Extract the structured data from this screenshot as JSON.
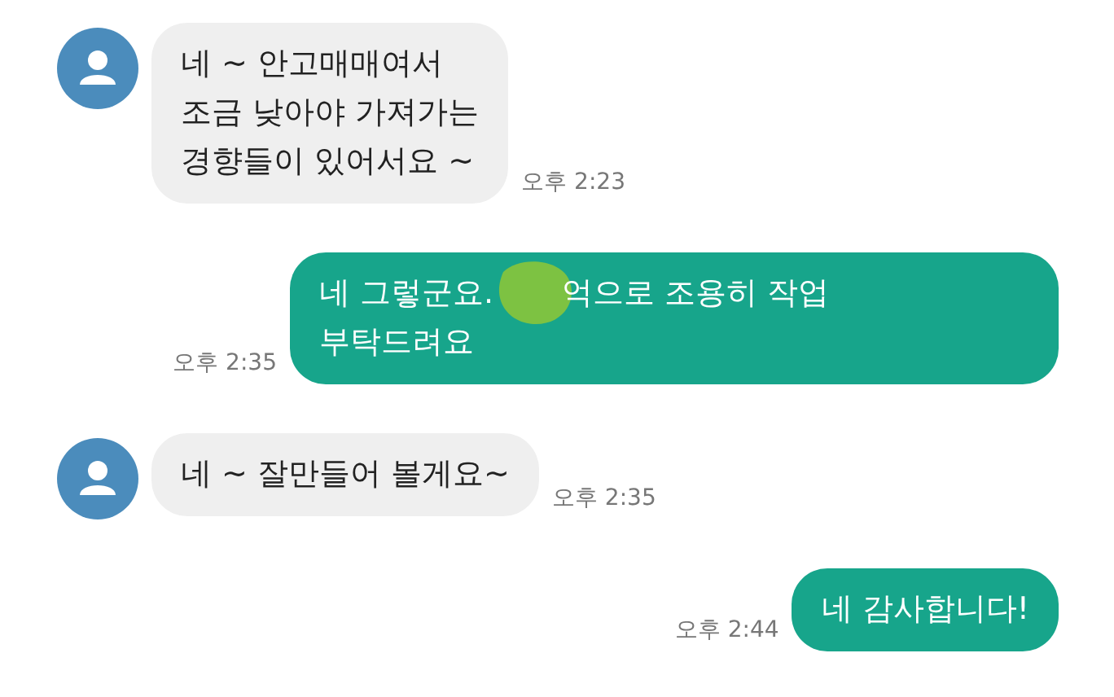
{
  "messages": [
    {
      "kind": "incoming",
      "lines": [
        [
          {
            "kind": "text",
            "text": "네 ~ 안고매매여서"
          }
        ],
        [
          {
            "kind": "text",
            "text": "조금 낮아야 가져가는"
          }
        ],
        [
          {
            "kind": "text",
            "text": "경향들이 있어서요 ~"
          }
        ]
      ],
      "time": "오후 2:23"
    },
    {
      "kind": "outgoing",
      "lines": [
        [
          {
            "kind": "text",
            "text": "네 그렇군요."
          },
          {
            "kind": "redaction"
          },
          {
            "kind": "text",
            "text": "억으로 조용히 작업"
          }
        ],
        [
          {
            "kind": "text",
            "text": "부탁드려요"
          }
        ]
      ],
      "time": "오후 2:35"
    },
    {
      "kind": "incoming",
      "lines": [
        [
          {
            "kind": "text",
            "text": "네 ~ 잘만들어 볼게요~"
          }
        ]
      ],
      "time": "오후 2:35"
    },
    {
      "kind": "outgoing",
      "lines": [
        [
          {
            "kind": "text",
            "text": "네 감사합니다!"
          }
        ]
      ],
      "time": "오후 2:44"
    }
  ]
}
